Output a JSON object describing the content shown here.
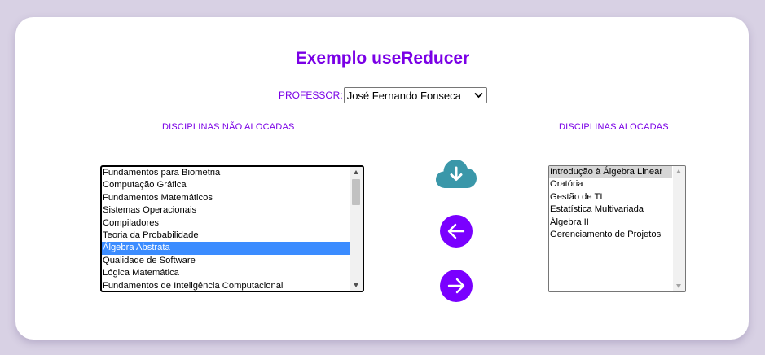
{
  "title": "Exemplo useReducer",
  "professor": {
    "label": "PROFESSOR:",
    "selected": "José Fernando Fonseca"
  },
  "columns": {
    "unallocated_header": "DISCIPLINAS NÃO ALOCADAS",
    "allocated_header": "DISCIPLINAS ALOCADAS"
  },
  "unallocated": [
    "Fundamentos para Biometria",
    "Computação Gráfica",
    "Fundamentos Matemáticos",
    "Sistemas Operacionais",
    "Compiladores",
    "Teoria da Probabilidade",
    "Álgebra Abstrata",
    "Qualidade de Software",
    "Lógica Matemática",
    "Fundamentos de Inteligência Computacional"
  ],
  "unallocated_selected": "Álgebra Abstrata",
  "allocated": [
    "Introdução à Álgebra Linear",
    "Oratória",
    "Gestão de TI",
    "Estatística Multivariada",
    "Álgebra II",
    "Gerenciamento de Projetos"
  ],
  "buttons": {
    "cloud_icon": "cloud-download-icon",
    "left_icon": "arrow-left-icon",
    "right_icon": "arrow-right-icon"
  },
  "colors": {
    "accent": "#7a00e6",
    "button": "#7a00ff",
    "cloud": "#3a97a9",
    "selection": "#3b8cff",
    "background": "#d8d1e4"
  }
}
